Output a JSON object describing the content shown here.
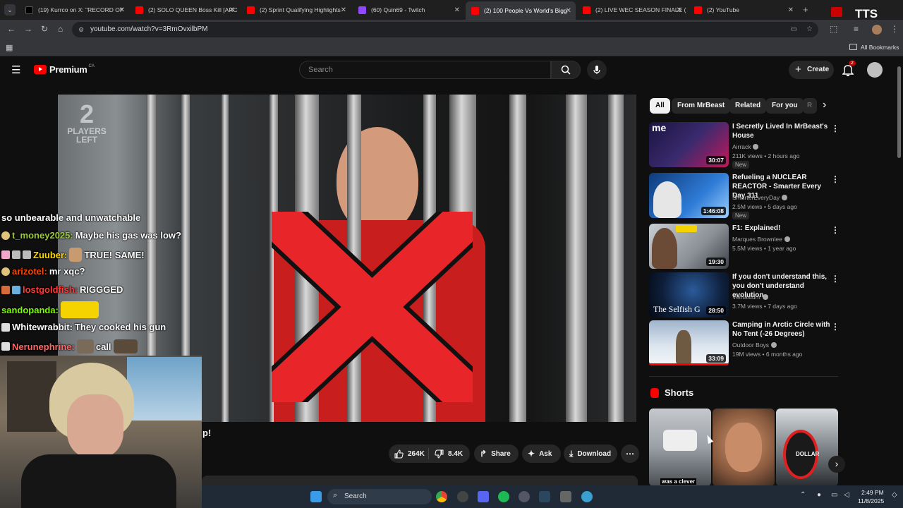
{
  "browser": {
    "tabs": [
      {
        "title": "(19) Kurrco on X: \"RECORD OF",
        "color": "#000000",
        "active": false
      },
      {
        "title": "(2) SOLO QUEEN Boss Kill [ARC",
        "color": "#ff0000",
        "active": false
      },
      {
        "title": "(2) Sprint Qualifying Highlights",
        "color": "#ff0000",
        "active": false
      },
      {
        "title": "(60) Quin69 - Twitch",
        "color": "#9146ff",
        "active": false
      },
      {
        "title": "(2) 100 People Vs World's Bigg",
        "color": "#ff0000",
        "active": true
      },
      {
        "title": "(2) LIVE WEC SEASON FINALE (",
        "color": "#ff0000",
        "active": false
      },
      {
        "title": "(2) YouTube",
        "color": "#ff0000",
        "active": false
      }
    ],
    "url": "youtube.com/watch?v=3RmOvxilbPM",
    "all_bookmarks": "All Bookmarks",
    "tts_label": "TTS"
  },
  "youtube": {
    "logo": "Premium",
    "region": "CA",
    "search_placeholder": "Search",
    "create_label": "Create",
    "notification_count": "2"
  },
  "video": {
    "players_left_number": "2",
    "players_left_label_1": "PLAYERS",
    "players_left_label_2": "LEFT",
    "title_fragment": "p!"
  },
  "chat": [
    {
      "user": "",
      "message": "so unbearable and unwatchable",
      "user_color": "#ffffff"
    },
    {
      "user": "t_money2025:",
      "message": "Maybe his gas was low?",
      "user_color": "#9acd32"
    },
    {
      "user": "Zuuber:",
      "message": "TRUE! SAME!",
      "user_color": "#ffd700"
    },
    {
      "user": "arizotel:",
      "message": "mr xqc?",
      "user_color": "#ff4500"
    },
    {
      "user": "lostgoldfish:",
      "message": "RIGGGED",
      "user_color": "#ff3b3b"
    },
    {
      "user": "sandopanda:",
      "message": "",
      "user_color": "#7cfc00"
    },
    {
      "user": "Whitewrabbit:",
      "message": "They cooked his gun",
      "user_color": "#ffffff"
    },
    {
      "user": "Nerunephrine:",
      "message": "call",
      "user_color": "#ff6666"
    }
  ],
  "actions": {
    "likes": "264K",
    "dislikes": "8.4K",
    "share": "Share",
    "ask": "Ask",
    "download": "Download"
  },
  "chips": [
    "All",
    "From MrBeast",
    "Related",
    "For you",
    "R"
  ],
  "recommendations": [
    {
      "title": "I Secretly Lived In MrBeast's House",
      "channel": "Airrack",
      "meta": "211K views • 2 hours ago",
      "badge": "New",
      "duration": "30:07",
      "thumb_color": "#3a2a6e"
    },
    {
      "title": "Refueling a NUCLEAR REACTOR - Smarter Every Day 311",
      "channel": "SmarterEveryDay",
      "meta": "2.5M views • 5 days ago",
      "badge": "New",
      "duration": "1:46:08",
      "thumb_color": "#1f5fb0"
    },
    {
      "title": "F1: Explained!",
      "channel": "Marques Brownlee",
      "meta": "5.5M views • 1 year ago",
      "badge": "",
      "duration": "19:30",
      "thumb_color": "#8a8f96"
    },
    {
      "title": "If you don't understand this, you don't understand evolution",
      "channel": "Veritasium",
      "meta": "3.7M views • 7 days ago",
      "badge": "",
      "duration": "28:50",
      "thumb_color": "#0e1e3a",
      "thumb_text": "The Selfish G"
    },
    {
      "title": "Camping in Arctic Circle with No Tent (-26 Degrees)",
      "channel": "Outdoor Boys",
      "meta": "19M views • 6 months ago",
      "badge": "",
      "duration": "33:09",
      "thumb_color": "#b9c7d6"
    }
  ],
  "shorts": {
    "heading": "Shorts",
    "items": [
      {
        "caption": "was a clever",
        "color": "#9aa0a6"
      },
      {
        "caption": "",
        "color": "#b07a55"
      },
      {
        "caption": "DOLLAR",
        "color": "#6e7479"
      }
    ]
  },
  "taskbar": {
    "search": "Search",
    "time": "2:49 PM",
    "date": "11/8/2025"
  }
}
